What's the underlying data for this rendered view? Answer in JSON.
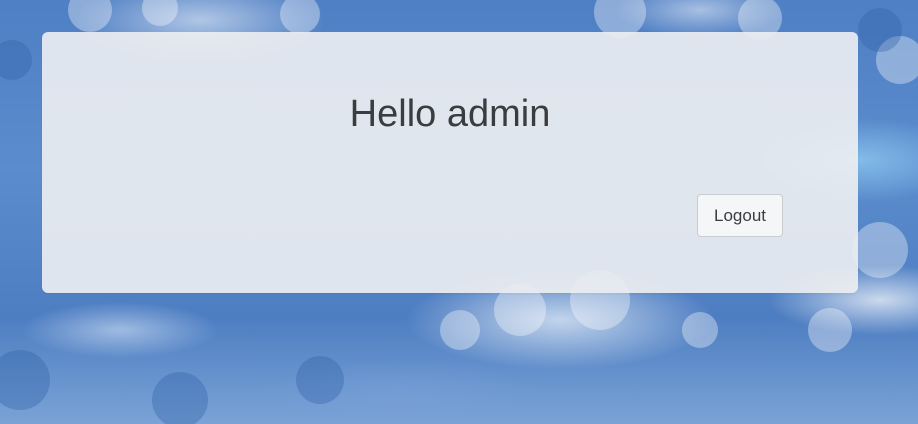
{
  "page": {
    "greeting": "Hello admin",
    "logout_label": "Logout"
  },
  "colors": {
    "sky": "#5b8ccd",
    "panel": "#eceef1",
    "text": "#3a3d40",
    "button_bg": "#f4f6f8",
    "button_border": "#c9cdd2"
  }
}
